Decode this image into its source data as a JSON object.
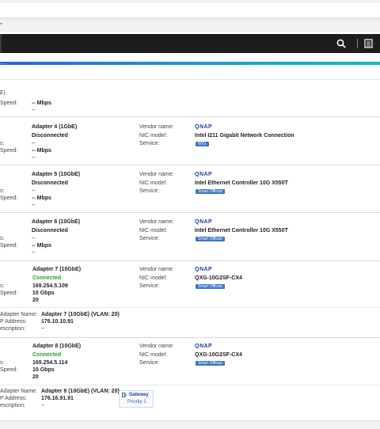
{
  "section_label": "Fi",
  "header": {
    "search_icon": "search-icon",
    "menu_icon": "clipboard-list-icon"
  },
  "accent": {
    "start": "#2a62d6",
    "end": "#17b8b0"
  },
  "top_fragment": {
    "speed_label": "Speed:",
    "speed_value": "-- Mbps",
    "extra_value": "--"
  },
  "labels": {
    "status": "s:",
    "speed": "Speed:",
    "vendor": "Vendor name:",
    "nic_model": "NIC model:",
    "service": "Service:",
    "adapter_name": "Adapter Name:",
    "ip_address": "P Address:",
    "description": "escription:"
  },
  "vendor_logo_text": "QNAP",
  "adapters": [
    {
      "name": "Adapter 4 (1GbE)",
      "status": "Disconnected",
      "ip": "--",
      "speed": "-- Mbps",
      "extra": "--",
      "nic_model": "Intel I211 Gigabit Network Connection",
      "service": "WOL"
    },
    {
      "name": "Adapter 5 (10GbE)",
      "status": "Disconnected",
      "ip": "--",
      "speed": "-- Mbps",
      "extra": "--",
      "nic_model": "Intel Ethernet Controller 10G X550T",
      "service": "Smart Offload"
    },
    {
      "name": "Adapter 6 (10GbE)",
      "status": "Disconnected",
      "ip": "--",
      "speed": "-- Mbps",
      "extra": "--",
      "nic_model": "Intel Ethernet Controller 10G X550T",
      "service": "Smart Offload"
    },
    {
      "name": "Adapter 7 (10GbE)",
      "status": "Connected",
      "ip": "169.254.5.109",
      "speed": "10 Gbps",
      "extra": "20",
      "nic_model": "QXG-10G2SF-CX4",
      "service": "Smart Offload",
      "vlan": {
        "name": "Adapter 7 (10GbE) (VLAN: 20)",
        "ip": "176.10.10.91",
        "description": "--"
      }
    },
    {
      "name": "Adapter 8 (10GbE)",
      "status": "Connected",
      "ip": "169.254.5.114",
      "speed": "10 Gbps",
      "extra": "20",
      "nic_model": "QXG-10G2SF-CX4",
      "service": "Smart Offload",
      "vlan": {
        "name": "Adapter 8 (10GbE) (VLAN: 20)",
        "ip": "176.16.91.91",
        "description": "--"
      }
    }
  ],
  "gateway": {
    "label": "Gateway",
    "priority": "Priority 1",
    "icon": "gateway-icon"
  }
}
